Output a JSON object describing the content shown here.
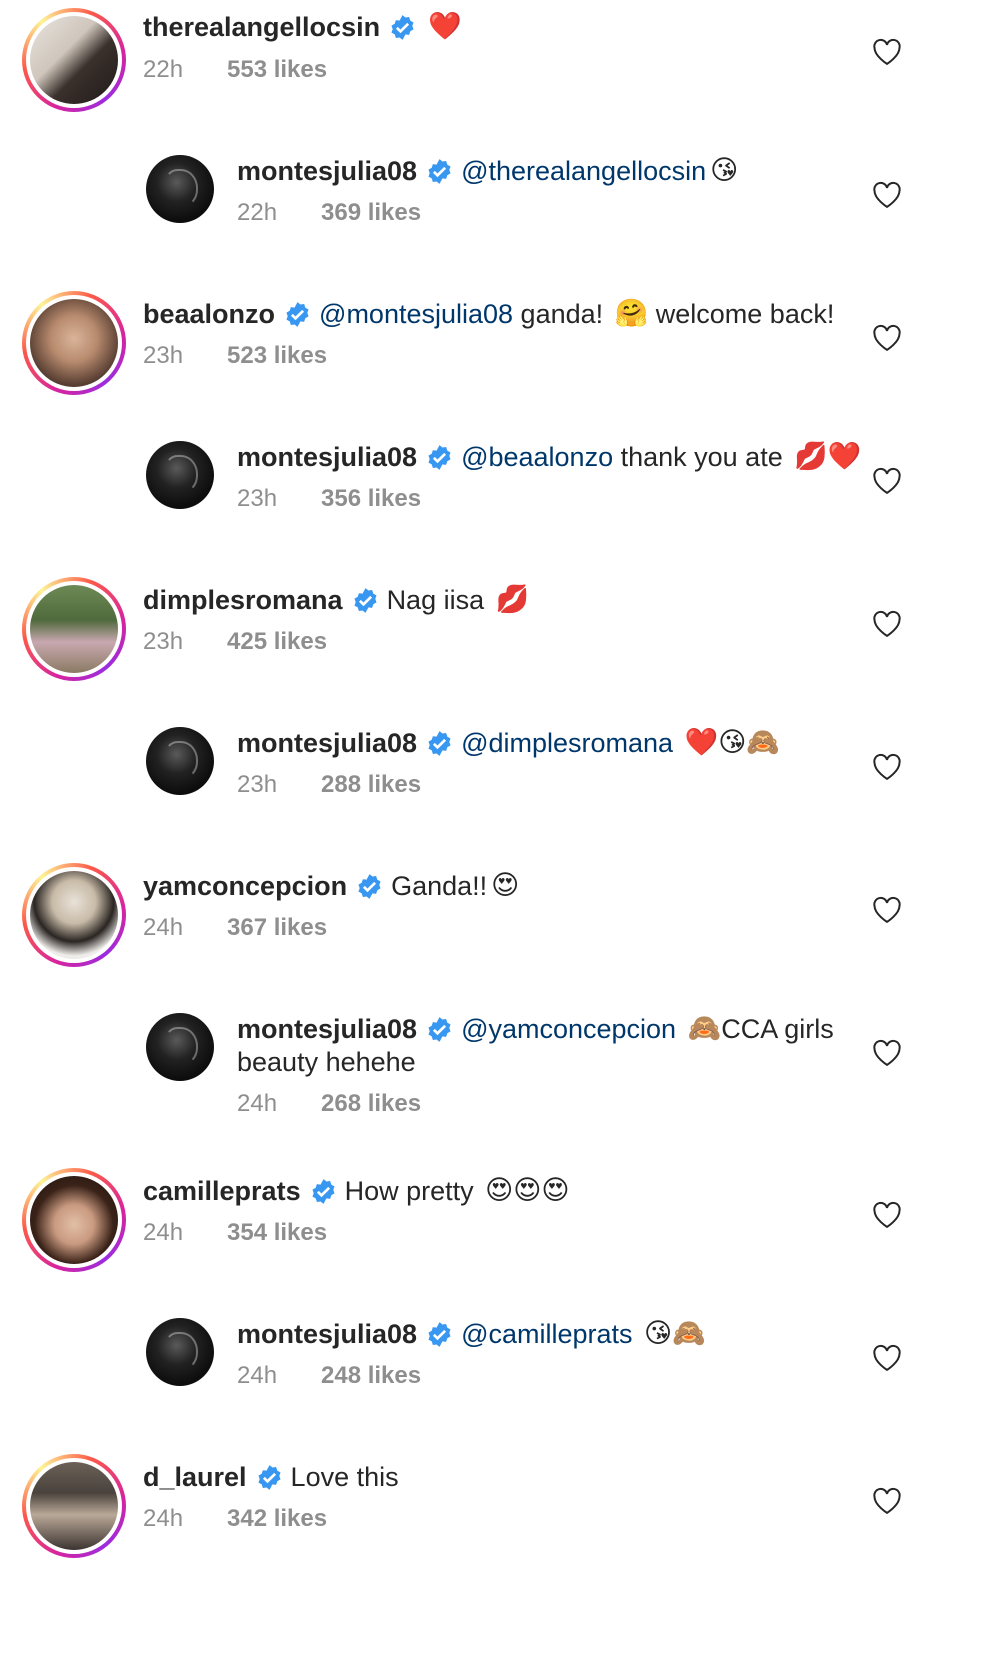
{
  "colors": {
    "verified": "#3897f0",
    "mention": "#00376b",
    "muted": "#8e8e8e",
    "heart_red": "#e0245e"
  },
  "icons": {
    "verified": "verified-badge-icon",
    "like": "heart-outline-icon"
  },
  "comments": [
    {
      "username": "therealangellocsin",
      "text": "",
      "mention": "",
      "emoji": "❤️",
      "time": "22h",
      "likes": "553 likes"
    },
    {
      "username": "montesjulia08",
      "mention": "@therealangellocsin",
      "text": "",
      "emoji": "😘",
      "time": "22h",
      "likes": "369 likes"
    },
    {
      "username": "beaalonzo",
      "mention": "@montesjulia08",
      "text": " ganda! ",
      "emoji": "🤗",
      "text2": " welcome back!",
      "time": "23h",
      "likes": "523 likes"
    },
    {
      "username": "montesjulia08",
      "mention": "@beaalonzo",
      "text": " thank you ate ",
      "emoji": "💋❤️",
      "time": "23h",
      "likes": "356 likes"
    },
    {
      "username": "dimplesromana",
      "mention": "",
      "text": "Nag iisa ",
      "emoji": "💋",
      "time": "23h",
      "likes": "425 likes"
    },
    {
      "username": "montesjulia08",
      "mention": "@dimplesromana",
      "text": " ",
      "emoji": "❤️😘🙈",
      "time": "23h",
      "likes": "288 likes"
    },
    {
      "username": "yamconcepcion",
      "mention": "",
      "text": "Ganda!!",
      "emoji": "😍",
      "time": "24h",
      "likes": "367 likes"
    },
    {
      "username": "montesjulia08",
      "mention": "@yamconcepcion",
      "text": " ",
      "emoji": "🙈",
      "text2": "CCA girls",
      "line2": "beauty hehehe",
      "time": "24h",
      "likes": "268 likes"
    },
    {
      "username": "camilleprats",
      "mention": "",
      "text": "How pretty ",
      "emoji": "😍😍😍",
      "time": "24h",
      "likes": "354 likes"
    },
    {
      "username": "montesjulia08",
      "mention": "@camilleprats",
      "text": " ",
      "emoji": "😘🙈",
      "time": "24h",
      "likes": "248 likes"
    },
    {
      "username": "d_laurel",
      "mention": "",
      "text": "Love this",
      "emoji": "",
      "time": "24h",
      "likes": "342 likes"
    }
  ]
}
